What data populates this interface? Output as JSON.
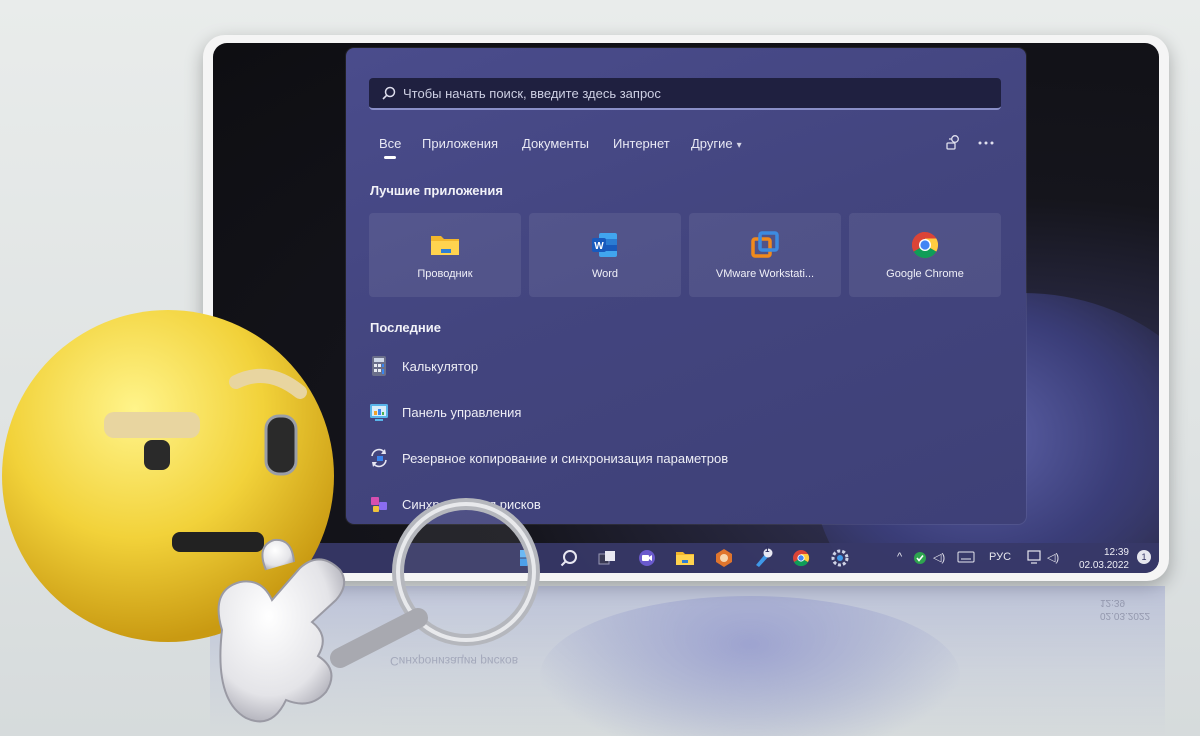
{
  "search": {
    "placeholder": "Чтобы начать поиск, введите здесь запрос"
  },
  "tabs": [
    {
      "label": "Все",
      "active": true
    },
    {
      "label": "Приложения"
    },
    {
      "label": "Документы"
    },
    {
      "label": "Интернет"
    },
    {
      "label": "Другие"
    }
  ],
  "header_icons": [
    "sign-in-icon",
    "more-options-icon"
  ],
  "top_apps": {
    "title": "Лучшие приложения",
    "items": [
      {
        "label": "Проводник",
        "icon": "file-explorer-icon"
      },
      {
        "label": "Word",
        "icon": "word-icon"
      },
      {
        "label": "VMware Workstati...",
        "icon": "vmware-icon"
      },
      {
        "label": "Google Chrome",
        "icon": "chrome-icon"
      }
    ]
  },
  "recent": {
    "title": "Последние",
    "items": [
      {
        "label": "Калькулятор",
        "icon": "calculator-icon"
      },
      {
        "label": "Панель управления",
        "icon": "control-panel-icon"
      },
      {
        "label": "Резервное копирование и синхронизация параметров",
        "icon": "backup-sync-icon"
      },
      {
        "label": "Синхронизация рисков",
        "icon": "sync-icon"
      }
    ]
  },
  "taskbar": {
    "icons": [
      "start-icon",
      "search-icon",
      "task-view-icon",
      "chat-icon",
      "file-explorer-icon",
      "app-icon",
      "pinned-app-icon",
      "chrome-icon",
      "settings-icon"
    ],
    "badge": "1",
    "language": "РУС",
    "time": "12:39",
    "date": "02.03.2022",
    "notifications": "1"
  },
  "reflection": {
    "recent_text": "Синхронизация рисков",
    "time": "12:39",
    "date": "02.03.2022"
  },
  "colors": {
    "start_menu_bg": "#44467f",
    "search_bg": "#1f2040",
    "taskbar_bg": "#373868",
    "frame": "#f5f5f5",
    "emoji_face": "#f2d23a"
  }
}
